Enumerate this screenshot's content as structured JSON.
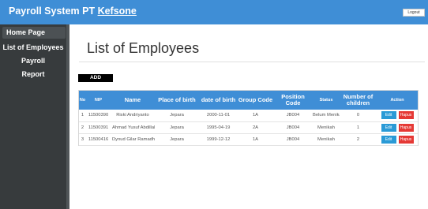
{
  "header": {
    "title": "Payroll System PT",
    "company": "Kefsone",
    "logout_label": "Logout"
  },
  "sidebar": {
    "items": [
      {
        "label": "Home Page"
      },
      {
        "label": "List of Employees"
      },
      {
        "label": "Payroll"
      },
      {
        "label": "Report"
      }
    ]
  },
  "main": {
    "title": "List of Employees",
    "add_label": "ADD"
  },
  "table": {
    "columns": [
      "No",
      "NIP",
      "Name",
      "Place of birth",
      "date of birth",
      "Group Code",
      "Position Code",
      "Status",
      "Number of children",
      "Action"
    ],
    "rows": [
      {
        "no": "1",
        "nip": "11500390",
        "name": "Riski Andriyanto",
        "place": "Jepara",
        "dob": "2000-11-01",
        "group": "1A",
        "position": "JB004",
        "status": "Belum Menikah",
        "children": "0"
      },
      {
        "no": "2",
        "nip": "11500391",
        "name": "Ahmad Yusuf Abdillah",
        "place": "Jepara",
        "dob": "1995-04-19",
        "group": "2A",
        "position": "JB004",
        "status": "Menikah",
        "children": "1"
      },
      {
        "no": "3",
        "nip": "11500416",
        "name": "Dynud Gilar Ramadhan",
        "place": "Jepara",
        "dob": "1999-12-12",
        "group": "1A",
        "position": "JB004",
        "status": "Menikah",
        "children": "2"
      }
    ],
    "edit_label": "Edit",
    "delete_label": "Hapus"
  },
  "colors": {
    "header_blue": "#3f8ed6",
    "sidebar_dark": "#373b3d",
    "edit_blue": "#2a9ad6",
    "delete_red": "#e53935"
  }
}
